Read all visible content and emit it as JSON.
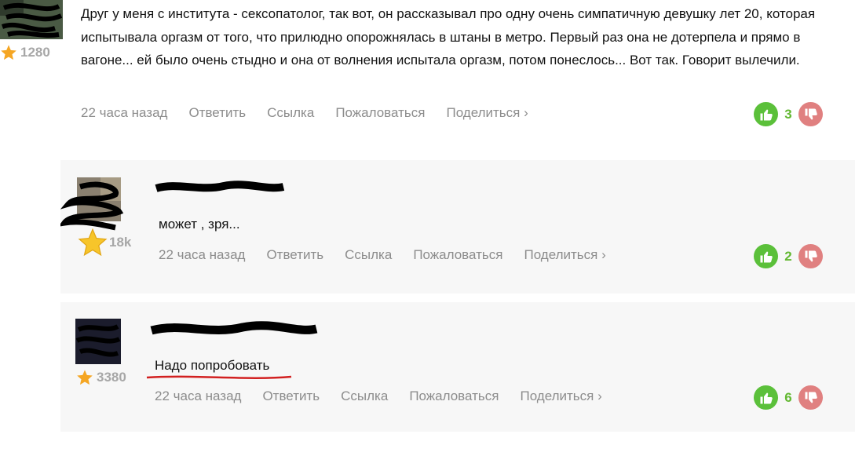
{
  "comments": [
    {
      "rating": "1280",
      "text": "Друг у меня с института - сексопатолог, так вот, он рассказывал про одну очень симпатичную девушку лет 20, которая испытывала оргазм от того, что прилюдно опорожнялась в штаны в метро. Первый раз она не дотерпела и прямо в вагоне... ей было очень стыдно и она от волнения испытала оргазм, потом понеслось... Вот так. Говорит вылечили.",
      "time": "22 часа назад",
      "actions": {
        "reply": "Ответить",
        "link": "Ссылка",
        "report": "Пожаловаться",
        "share": "Поделиться"
      },
      "votes": "3"
    },
    {
      "rating": "18k",
      "text": "может , зря...",
      "time": "22 часа назад",
      "actions": {
        "reply": "Ответить",
        "link": "Ссылка",
        "report": "Пожаловаться",
        "share": "Поделиться"
      },
      "votes": "2"
    },
    {
      "rating": "3380",
      "text": "Надо попробовать",
      "time": "22 часа назад",
      "actions": {
        "reply": "Ответить",
        "link": "Ссылка",
        "report": "Пожаловаться",
        "share": "Поделиться"
      },
      "votes": "6"
    }
  ],
  "colors": {
    "vote_up": "#5bc03a",
    "vote_down": "#e08080",
    "vote_count": "#63b832",
    "meta_text": "#8c8c8c",
    "reply_background": "#f7f7f7",
    "underline": "#d22020"
  },
  "icons": [
    "star-icon",
    "thumbs-up-icon",
    "thumbs-down-icon",
    "chevron-right-icon"
  ]
}
